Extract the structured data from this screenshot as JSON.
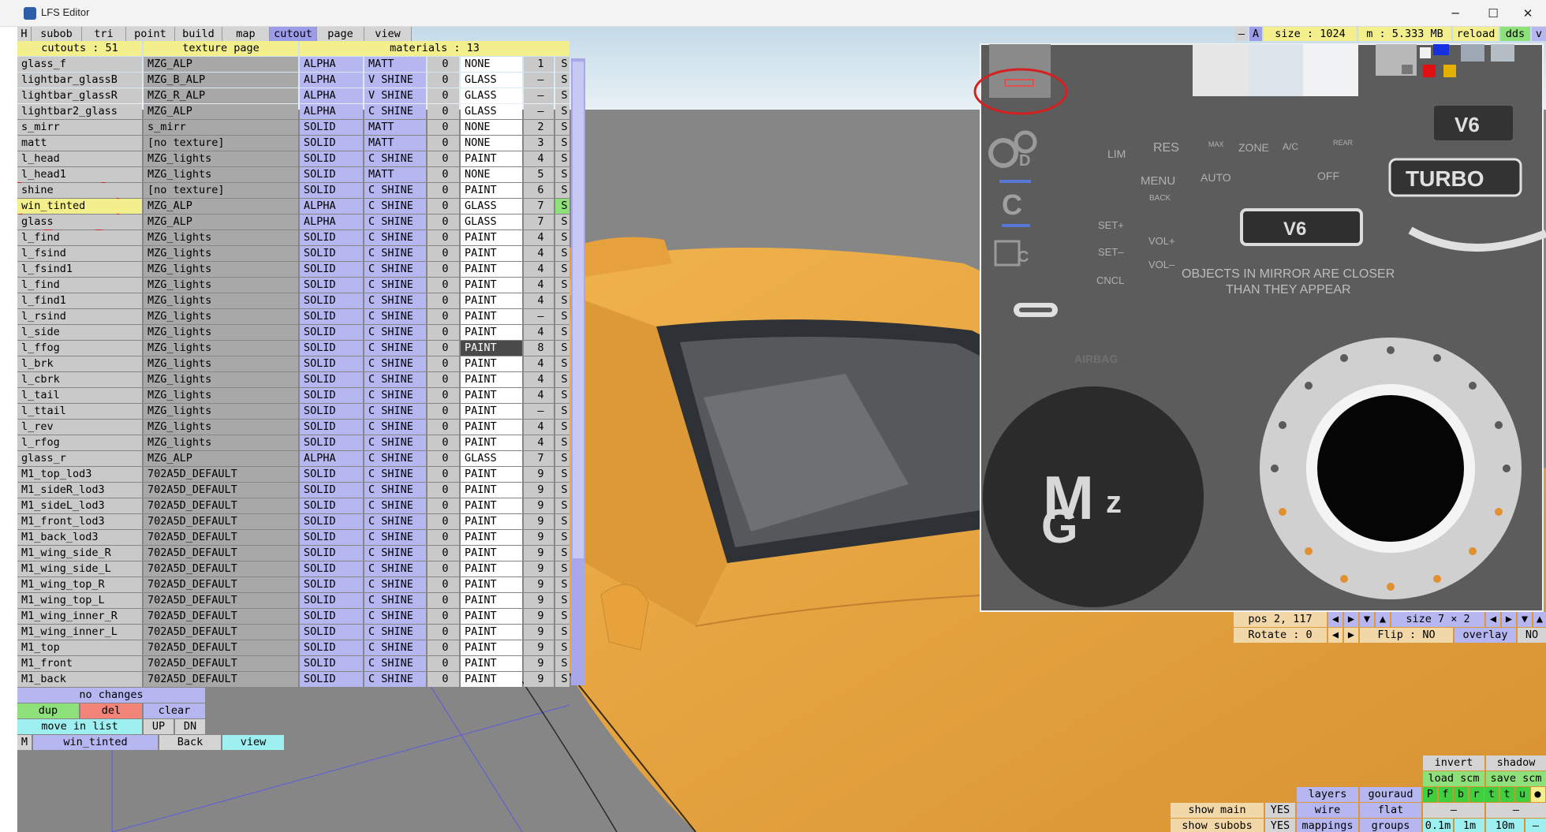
{
  "window": {
    "title": "LFS Editor",
    "minimize": "─",
    "maximize": "☐",
    "close": "✕"
  },
  "menu": [
    {
      "label": "H",
      "w": 18
    },
    {
      "label": "subob",
      "w": 64
    },
    {
      "label": "tri",
      "w": 56
    },
    {
      "label": "point",
      "w": 62
    },
    {
      "label": "build",
      "w": 60
    },
    {
      "label": "map",
      "w": 60
    },
    {
      "label": "cutout",
      "w": 60,
      "active": true
    },
    {
      "label": "page",
      "w": 60
    },
    {
      "label": "view",
      "w": 60
    }
  ],
  "header": {
    "cutouts": "cutouts : 51",
    "texture": "texture page",
    "materials": "materials : 13"
  },
  "rows": [
    [
      "glass_f",
      "MZG_ALP",
      "ALPHA",
      "MATT",
      "0",
      "NONE",
      "1",
      "S"
    ],
    [
      "lightbar_glassB",
      "MZG_B_ALP",
      "ALPHA",
      "V SHINE",
      "0",
      "GLASS",
      "–",
      "S"
    ],
    [
      "lightbar_glassR",
      "MZG_R_ALP",
      "ALPHA",
      "V SHINE",
      "0",
      "GLASS",
      "–",
      "S"
    ],
    [
      "lightbar2_glass",
      "MZG_ALP",
      "ALPHA",
      "C SHINE",
      "0",
      "GLASS",
      "–",
      "S"
    ],
    [
      "s_mirr",
      "s_mirr",
      "SOLID",
      "MATT",
      "0",
      "NONE",
      "2",
      "S"
    ],
    [
      "matt",
      "[no texture]",
      "SOLID",
      "MATT",
      "0",
      "NONE",
      "3",
      "S"
    ],
    [
      "l_head",
      "MZG_lights",
      "SOLID",
      "C SHINE",
      "0",
      "PAINT",
      "4",
      "S"
    ],
    [
      "l_head1",
      "MZG_lights",
      "SOLID",
      "MATT",
      "0",
      "NONE",
      "5",
      "S"
    ],
    [
      "shine",
      "[no texture]",
      "SOLID",
      "C SHINE",
      "0",
      "PAINT",
      "6",
      "S"
    ],
    [
      "win_tinted",
      "MZG_ALP",
      "ALPHA",
      "C SHINE",
      "0",
      "GLASS",
      "7",
      "S"
    ],
    [
      "glass",
      "MZG_ALP",
      "ALPHA",
      "C SHINE",
      "0",
      "GLASS",
      "7",
      "S"
    ],
    [
      "l_find",
      "MZG_lights",
      "SOLID",
      "C SHINE",
      "0",
      "PAINT",
      "4",
      "S"
    ],
    [
      "l_fsind",
      "MZG_lights",
      "SOLID",
      "C SHINE",
      "0",
      "PAINT",
      "4",
      "S"
    ],
    [
      "l_fsind1",
      "MZG_lights",
      "SOLID",
      "C SHINE",
      "0",
      "PAINT",
      "4",
      "S"
    ],
    [
      "l_find",
      "MZG_lights",
      "SOLID",
      "C SHINE",
      "0",
      "PAINT",
      "4",
      "S"
    ],
    [
      "l_find1",
      "MZG_lights",
      "SOLID",
      "C SHINE",
      "0",
      "PAINT",
      "4",
      "S"
    ],
    [
      "l_rsind",
      "MZG_lights",
      "SOLID",
      "C SHINE",
      "0",
      "PAINT",
      "–",
      "S"
    ],
    [
      "l_side",
      "MZG_lights",
      "SOLID",
      "C SHINE",
      "0",
      "PAINT",
      "4",
      "S"
    ],
    [
      "l_ffog",
      "MZG_lights",
      "SOLID",
      "C SHINE",
      "0",
      "PAINT",
      "8",
      "S"
    ],
    [
      "l_brk",
      "MZG_lights",
      "SOLID",
      "C SHINE",
      "0",
      "PAINT",
      "4",
      "S"
    ],
    [
      "l_cbrk",
      "MZG_lights",
      "SOLID",
      "C SHINE",
      "0",
      "PAINT",
      "4",
      "S"
    ],
    [
      "l_tail",
      "MZG_lights",
      "SOLID",
      "C SHINE",
      "0",
      "PAINT",
      "4",
      "S"
    ],
    [
      "l_ttail",
      "MZG_lights",
      "SOLID",
      "C SHINE",
      "0",
      "PAINT",
      "–",
      "S"
    ],
    [
      "l_rev",
      "MZG_lights",
      "SOLID",
      "C SHINE",
      "0",
      "PAINT",
      "4",
      "S"
    ],
    [
      "l_rfog",
      "MZG_lights",
      "SOLID",
      "C SHINE",
      "0",
      "PAINT",
      "4",
      "S"
    ],
    [
      "glass_r",
      "MZG_ALP",
      "ALPHA",
      "C SHINE",
      "0",
      "GLASS",
      "7",
      "S"
    ],
    [
      "M1_top_lod3",
      "702A5D_DEFAULT",
      "SOLID",
      "C SHINE",
      "0",
      "PAINT",
      "9",
      "S"
    ],
    [
      "M1_sideR_lod3",
      "702A5D_DEFAULT",
      "SOLID",
      "C SHINE",
      "0",
      "PAINT",
      "9",
      "S"
    ],
    [
      "M1_sideL_lod3",
      "702A5D_DEFAULT",
      "SOLID",
      "C SHINE",
      "0",
      "PAINT",
      "9",
      "S"
    ],
    [
      "M1_front_lod3",
      "702A5D_DEFAULT",
      "SOLID",
      "C SHINE",
      "0",
      "PAINT",
      "9",
      "S"
    ],
    [
      "M1_back_lod3",
      "702A5D_DEFAULT",
      "SOLID",
      "C SHINE",
      "0",
      "PAINT",
      "9",
      "S"
    ],
    [
      "M1_wing_side_R",
      "702A5D_DEFAULT",
      "SOLID",
      "C SHINE",
      "0",
      "PAINT",
      "9",
      "S"
    ],
    [
      "M1_wing_side_L",
      "702A5D_DEFAULT",
      "SOLID",
      "C SHINE",
      "0",
      "PAINT",
      "9",
      "S"
    ],
    [
      "M1_wing_top_R",
      "702A5D_DEFAULT",
      "SOLID",
      "C SHINE",
      "0",
      "PAINT",
      "9",
      "S"
    ],
    [
      "M1_wing_top_L",
      "702A5D_DEFAULT",
      "SOLID",
      "C SHINE",
      "0",
      "PAINT",
      "9",
      "S"
    ],
    [
      "M1_wing_inner_R",
      "702A5D_DEFAULT",
      "SOLID",
      "C SHINE",
      "0",
      "PAINT",
      "9",
      "S"
    ],
    [
      "M1_wing_inner_L",
      "702A5D_DEFAULT",
      "SOLID",
      "C SHINE",
      "0",
      "PAINT",
      "9",
      "S"
    ],
    [
      "M1_top",
      "702A5D_DEFAULT",
      "SOLID",
      "C SHINE",
      "0",
      "PAINT",
      "9",
      "S"
    ],
    [
      "M1_front",
      "702A5D_DEFAULT",
      "SOLID",
      "C SHINE",
      "0",
      "PAINT",
      "9",
      "S"
    ],
    [
      "M1_back",
      "702A5D_DEFAULT",
      "SOLID",
      "C SHINE",
      "0",
      "PAINT",
      "9",
      "S"
    ]
  ],
  "selected_row": 9,
  "dark_paint_row": 18,
  "edit": {
    "status": "no changes",
    "dup": "dup",
    "del": "del",
    "clear": "clear",
    "move": "move in list",
    "up": "UP",
    "dn": "DN",
    "m": "M",
    "name": "win_tinted",
    "back": "Back",
    "view": "view"
  },
  "right_top": {
    "minus": "–",
    "a": "A",
    "size": "size : 1024",
    "mem": "m : 5.333 MB",
    "reload": "reload",
    "dds": "dds",
    "v": "v"
  },
  "texture_labels": {
    "res": "RES",
    "lim": "LIM",
    "max": "MAX",
    "zone": "ZONE",
    "ac": "A/C",
    "rear": "REAR",
    "menu": "MENU",
    "back": "BACK",
    "auto": "AUTO",
    "off": "OFF",
    "set_plus": "SET+",
    "set_minus": "SET–",
    "cncl": "CNCL",
    "vol_plus": "VOL+",
    "vol_minus": "VOL–",
    "v6": "V6",
    "turbo": "TURBO",
    "mirror1": "OBJECTS IN MIRROR ARE CLOSER",
    "mirror2": "THAN THEY APPEAR",
    "airbag": "AIRBAG",
    "c": "C",
    "d": "D"
  },
  "pos_panel": {
    "pos": "pos 2, 117",
    "size": "size 7 × 2",
    "rotate": "Rotate : 0",
    "flip": "Flip : NO",
    "overlay": "overlay",
    "no": "NO"
  },
  "bottom_right": {
    "invert": "invert",
    "shadow": "shadow",
    "load_scm": "load scm",
    "save_scm": "save scm",
    "layers": "layers",
    "gouraud": "gouraud",
    "wire": "wire",
    "flat": "flat",
    "mappings": "mappings",
    "groups": "groups",
    "show_main": "show main",
    "show_subobs": "show subobs",
    "yes1": "YES",
    "yes2": "YES",
    "letters": [
      "P",
      "f",
      "b",
      "r",
      "t",
      "t",
      "u",
      "●"
    ],
    "m01": "0.1m",
    "m1": "1m",
    "m10": "10m",
    "dash1": "–",
    "dash2": "–",
    "dash3": "–"
  },
  "colors": {
    "car": "#e8a23c",
    "panel_gray": "#c9c9c9",
    "blue_cell": "#b6b6f0",
    "yellow": "#f2ef8c",
    "selection_red": "#d42020"
  }
}
